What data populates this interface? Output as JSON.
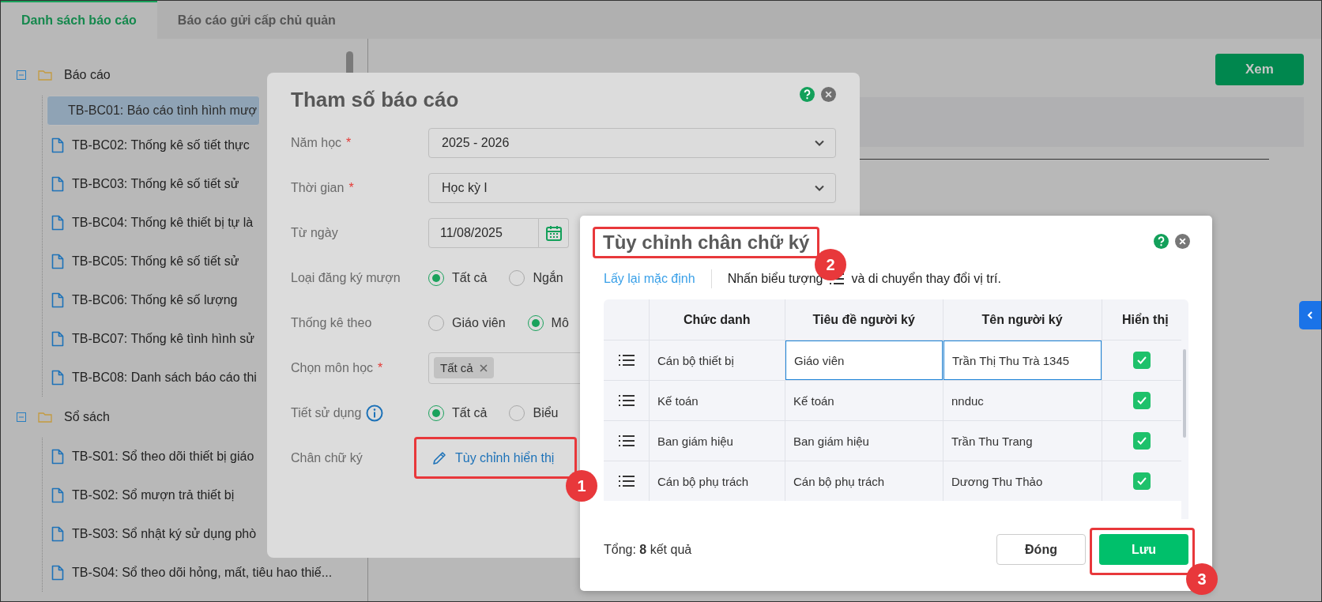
{
  "tabs": [
    {
      "label": "Danh sách báo cáo",
      "selected": true
    },
    {
      "label": "Báo cáo gửi cấp chủ quản",
      "selected": false
    }
  ],
  "tree": [
    {
      "label": "Báo cáo",
      "expanded": true,
      "children": [
        {
          "label": "TB-BC01: Báo cáo tình hình mượ",
          "selected": true
        },
        {
          "label": "TB-BC02: Thống kê số tiết thực",
          "selected": false
        },
        {
          "label": "TB-BC03: Thống kê số tiết sử",
          "selected": false
        },
        {
          "label": "TB-BC04: Thống kê thiết bị tự là",
          "selected": false
        },
        {
          "label": "TB-BC05: Thống kê số tiết sử",
          "selected": false
        },
        {
          "label": "TB-BC06: Thống kê số lượng",
          "selected": false
        },
        {
          "label": "TB-BC07: Thống kê tình hình sử",
          "selected": false
        },
        {
          "label": "TB-BC08: Danh sách báo cáo thi",
          "selected": false
        }
      ]
    },
    {
      "label": "Sổ sách",
      "expanded": true,
      "children": [
        {
          "label": "TB-S01: Sổ theo dõi thiết bị giáo",
          "selected": false
        },
        {
          "label": "TB-S02: Sổ mượn trả thiết bị",
          "selected": false
        },
        {
          "label": "TB-S03: Sổ nhật ký sử dụng phò",
          "selected": false
        },
        {
          "label": "TB-S04: Sổ theo dõi hỏng, mất, tiêu hao thiế...",
          "selected": false
        }
      ]
    }
  ],
  "view_button": "Xem",
  "report_dialog": {
    "title": "Tham số báo cáo",
    "fields": [
      {
        "kind": "select",
        "label": "Năm học",
        "required_mark": "*",
        "value": "2025 - 2026"
      },
      {
        "kind": "select",
        "label": "Thời gian",
        "required_mark": "*",
        "value": "Học kỳ I"
      },
      {
        "kind": "date",
        "label": "Từ ngày",
        "value": "11/08/2025"
      },
      {
        "kind": "radio",
        "label": "Loại đăng ký mượn",
        "options": [
          {
            "label": "Tất cả",
            "selected": true
          },
          {
            "label": "Ngắn",
            "selected": false
          }
        ]
      },
      {
        "kind": "radio",
        "label": "Thống kê theo",
        "options": [
          {
            "label": "Giáo viên",
            "selected": false
          },
          {
            "label": "Mô",
            "selected": true
          }
        ]
      },
      {
        "kind": "tags",
        "label": "Chọn môn học",
        "required_mark": "*",
        "tags": [
          "Tất cả"
        ]
      },
      {
        "kind": "radio",
        "label": "Tiết sử dụng",
        "info": true,
        "options": [
          {
            "label": "Tất cả",
            "selected": true
          },
          {
            "label": "Biểu",
            "selected": false
          }
        ]
      },
      {
        "kind": "link",
        "label": "Chân chữ ký",
        "value": "Tùy chỉnh hiển thị"
      }
    ]
  },
  "signature_dialog": {
    "title": "Tùy chỉnh chân chữ ký",
    "reset_link": "Lấy lại mặc định",
    "hint_before": "Nhấn biểu tượng",
    "hint_after": "và di chuyển thay đổi vị trí.",
    "columns": [
      "Chức danh",
      "Tiêu đề người ký",
      "Tên người ký",
      "Hiển thị"
    ],
    "rows": [
      {
        "title": "Cán bộ thiết bị",
        "signer_title": "Giáo viên",
        "signer_name": "Trần Thị Thu Trà 1345",
        "shown": true,
        "editing": true
      },
      {
        "title": "Kế toán",
        "signer_title": "Kế toán",
        "signer_name": "nnduc",
        "shown": true,
        "editing": false
      },
      {
        "title": "Ban giám hiệu",
        "signer_title": "Ban giám hiệu",
        "signer_name": "Trần Thu Trang",
        "shown": true,
        "editing": false
      },
      {
        "title": "Cán bộ phụ trách",
        "signer_title": "Cán bộ phụ trách",
        "signer_name": "Dương Thu Thảo",
        "shown": true,
        "editing": false
      }
    ],
    "total": "Tổng: **8** kết quả",
    "buttons": [
      {
        "label": "Đóng",
        "kind": "secondary"
      },
      {
        "label": "Lưu",
        "kind": "primary"
      }
    ]
  },
  "callouts": [
    "1",
    "2",
    "3"
  ]
}
